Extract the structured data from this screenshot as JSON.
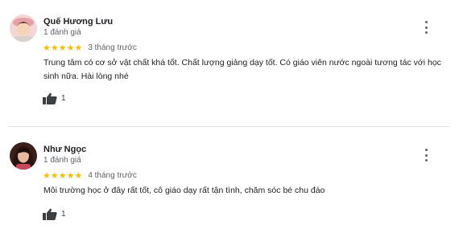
{
  "reviews": [
    {
      "author": "Quế Hương Lưu",
      "review_count": "1 đánh giá",
      "stars": "★★★★★",
      "rating": 5,
      "date": "3 tháng trước",
      "text": "Trung tâm có cơ sở vật chất khá tốt. Chất lượng giảng dạy tốt. Có giáo viên nước ngoài tương tác với học sinh nữa. Hài lòng nhé",
      "likes": "1",
      "avatar_icon": "profile-photo",
      "menu_icon": "more-vert-icon"
    },
    {
      "author": "Như Ngọc",
      "review_count": "1 đánh giá",
      "stars": "★★★★★",
      "rating": 5,
      "date": "4 tháng trước",
      "text": "Môi trường học ở đây rất tốt, cô giáo dạy rất tận tình, chăm sóc bé chu đáo",
      "likes": "1",
      "avatar_icon": "profile-photo",
      "menu_icon": "more-vert-icon"
    }
  ],
  "colors": {
    "star": "#fbbc04",
    "secondary_text": "#5f6368",
    "divider": "#e0e0e0"
  }
}
